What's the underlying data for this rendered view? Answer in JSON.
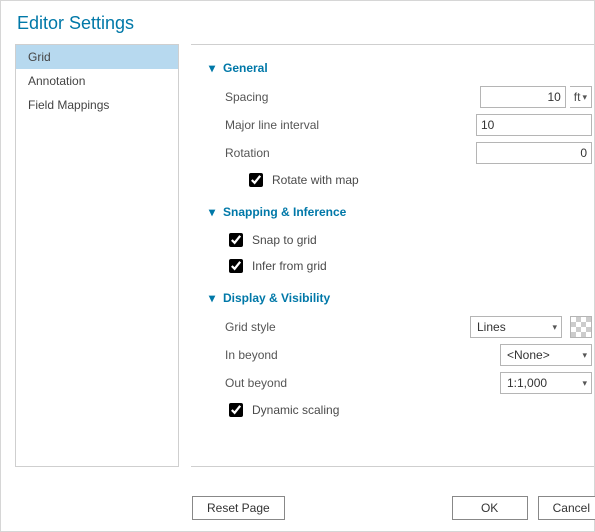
{
  "window": {
    "title": "Editor Settings"
  },
  "sidebar": {
    "items": [
      {
        "label": "Grid",
        "selected": true
      },
      {
        "label": "Annotation",
        "selected": false
      },
      {
        "label": "Field Mappings",
        "selected": false
      }
    ]
  },
  "sections": {
    "general": {
      "title": "General",
      "spacing_label": "Spacing",
      "spacing_value": "10",
      "spacing_unit": "ft",
      "major_label": "Major line interval",
      "major_value": "10",
      "rotation_label": "Rotation",
      "rotation_value": "0",
      "rotate_with_map_label": "Rotate with map",
      "rotate_with_map_checked": true
    },
    "snapping": {
      "title": "Snapping & Inference",
      "snap_label": "Snap to grid",
      "snap_checked": true,
      "infer_label": "Infer from grid",
      "infer_checked": true
    },
    "display": {
      "title": "Display & Visibility",
      "grid_style_label": "Grid style",
      "grid_style_value": "Lines",
      "in_beyond_label": "In beyond",
      "in_beyond_value": "<None>",
      "out_beyond_label": "Out beyond",
      "out_beyond_value": "1:1,000",
      "dynamic_label": "Dynamic scaling",
      "dynamic_checked": true
    }
  },
  "footer": {
    "reset_label": "Reset Page",
    "ok_label": "OK",
    "cancel_label": "Cancel"
  }
}
